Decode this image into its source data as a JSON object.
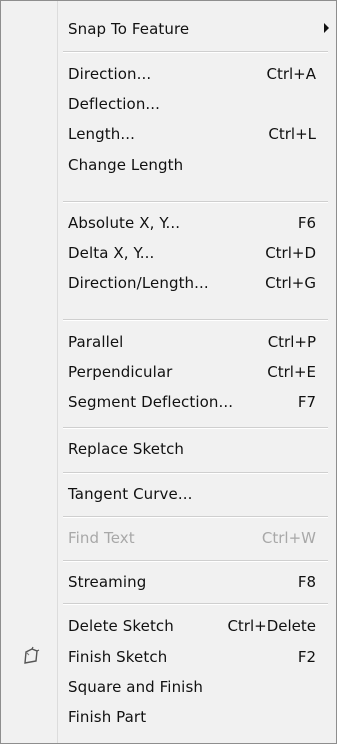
{
  "menu": {
    "items": [
      {
        "label": "Snap To Feature",
        "shortcut": "",
        "has_submenu": true
      },
      {
        "label": "Direction...",
        "shortcut": "Ctrl+A"
      },
      {
        "label": "Deflection...",
        "shortcut": ""
      },
      {
        "label": "Length...",
        "shortcut": "Ctrl+L"
      },
      {
        "label": "Change Length",
        "shortcut": ""
      },
      {
        "label": "Absolute X, Y...",
        "shortcut": "F6"
      },
      {
        "label": "Delta X, Y...",
        "shortcut": "Ctrl+D"
      },
      {
        "label": "Direction/Length...",
        "shortcut": "Ctrl+G"
      },
      {
        "label": "Parallel",
        "shortcut": "Ctrl+P"
      },
      {
        "label": "Perpendicular",
        "shortcut": "Ctrl+E"
      },
      {
        "label": "Segment Deflection...",
        "shortcut": "F7"
      },
      {
        "label": "Replace Sketch",
        "shortcut": ""
      },
      {
        "label": "Tangent Curve...",
        "shortcut": ""
      },
      {
        "label": "Find Text",
        "shortcut": "Ctrl+W",
        "disabled": true
      },
      {
        "label": "Streaming",
        "shortcut": "F8"
      },
      {
        "label": "Delete Sketch",
        "shortcut": "Ctrl+Delete"
      },
      {
        "label": "Finish Sketch",
        "shortcut": "F2",
        "icon": "finish-sketch-icon"
      },
      {
        "label": "Square and Finish",
        "shortcut": ""
      },
      {
        "label": "Finish Part",
        "shortcut": ""
      }
    ]
  },
  "colors": {
    "menu_background": "#f1f1f1",
    "text": "#111111",
    "disabled_text": "#a8a8a8",
    "separator": "#cfcfcf",
    "border": "#8e8e8e"
  }
}
